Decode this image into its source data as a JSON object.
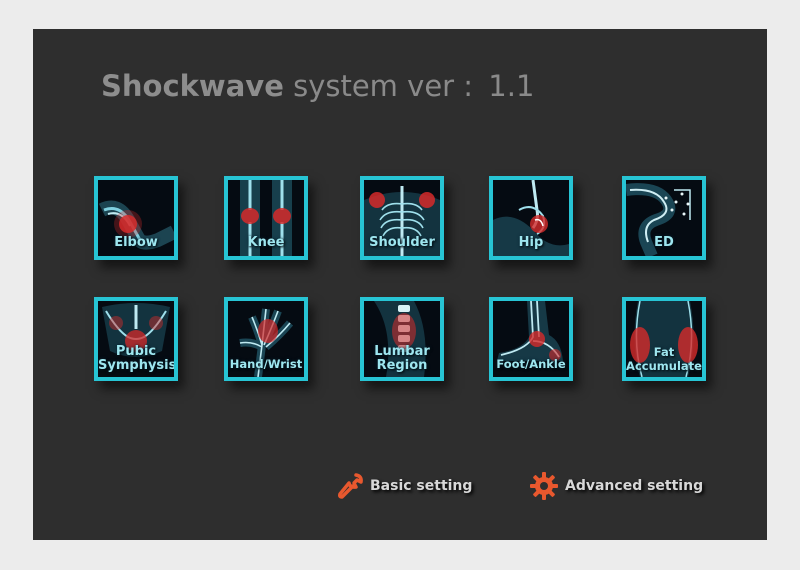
{
  "header": {
    "brand": "Shockwave",
    "subtitle": "system ver :",
    "version": "1.1"
  },
  "treatment_tiles": [
    {
      "label": "Elbow",
      "icon": "elbow-xray-icon"
    },
    {
      "label": "Knee",
      "icon": "knee-xray-icon"
    },
    {
      "label": "Shoulder",
      "icon": "shoulder-xray-icon"
    },
    {
      "label": "Hip",
      "icon": "hip-xray-icon"
    },
    {
      "label": "ED",
      "icon": "ed-xray-icon"
    },
    {
      "label_line1": "Pubic",
      "label_line2": "Symphysis",
      "icon": "pelvis-xray-icon"
    },
    {
      "label": "Hand/Wrist",
      "icon": "hand-xray-icon"
    },
    {
      "label_line1": "Lumbar",
      "label_line2": "Region",
      "icon": "spine-xray-icon"
    },
    {
      "label": "Foot/Ankle",
      "icon": "foot-xray-icon"
    },
    {
      "label_line1": "Fat",
      "label_line2": "Accumulate",
      "icon": "abdomen-xray-icon"
    }
  ],
  "settings": {
    "basic_label": "Basic setting",
    "basic_icon": "wrench-icon",
    "advanced_label": "Advanced setting",
    "advanced_icon": "gear-icon"
  },
  "colors": {
    "screen_bg": "#2e2e2e",
    "tile_border": "#27c4d4",
    "highlight_red": "#d62a2a",
    "icon_orange": "#e8582e"
  }
}
